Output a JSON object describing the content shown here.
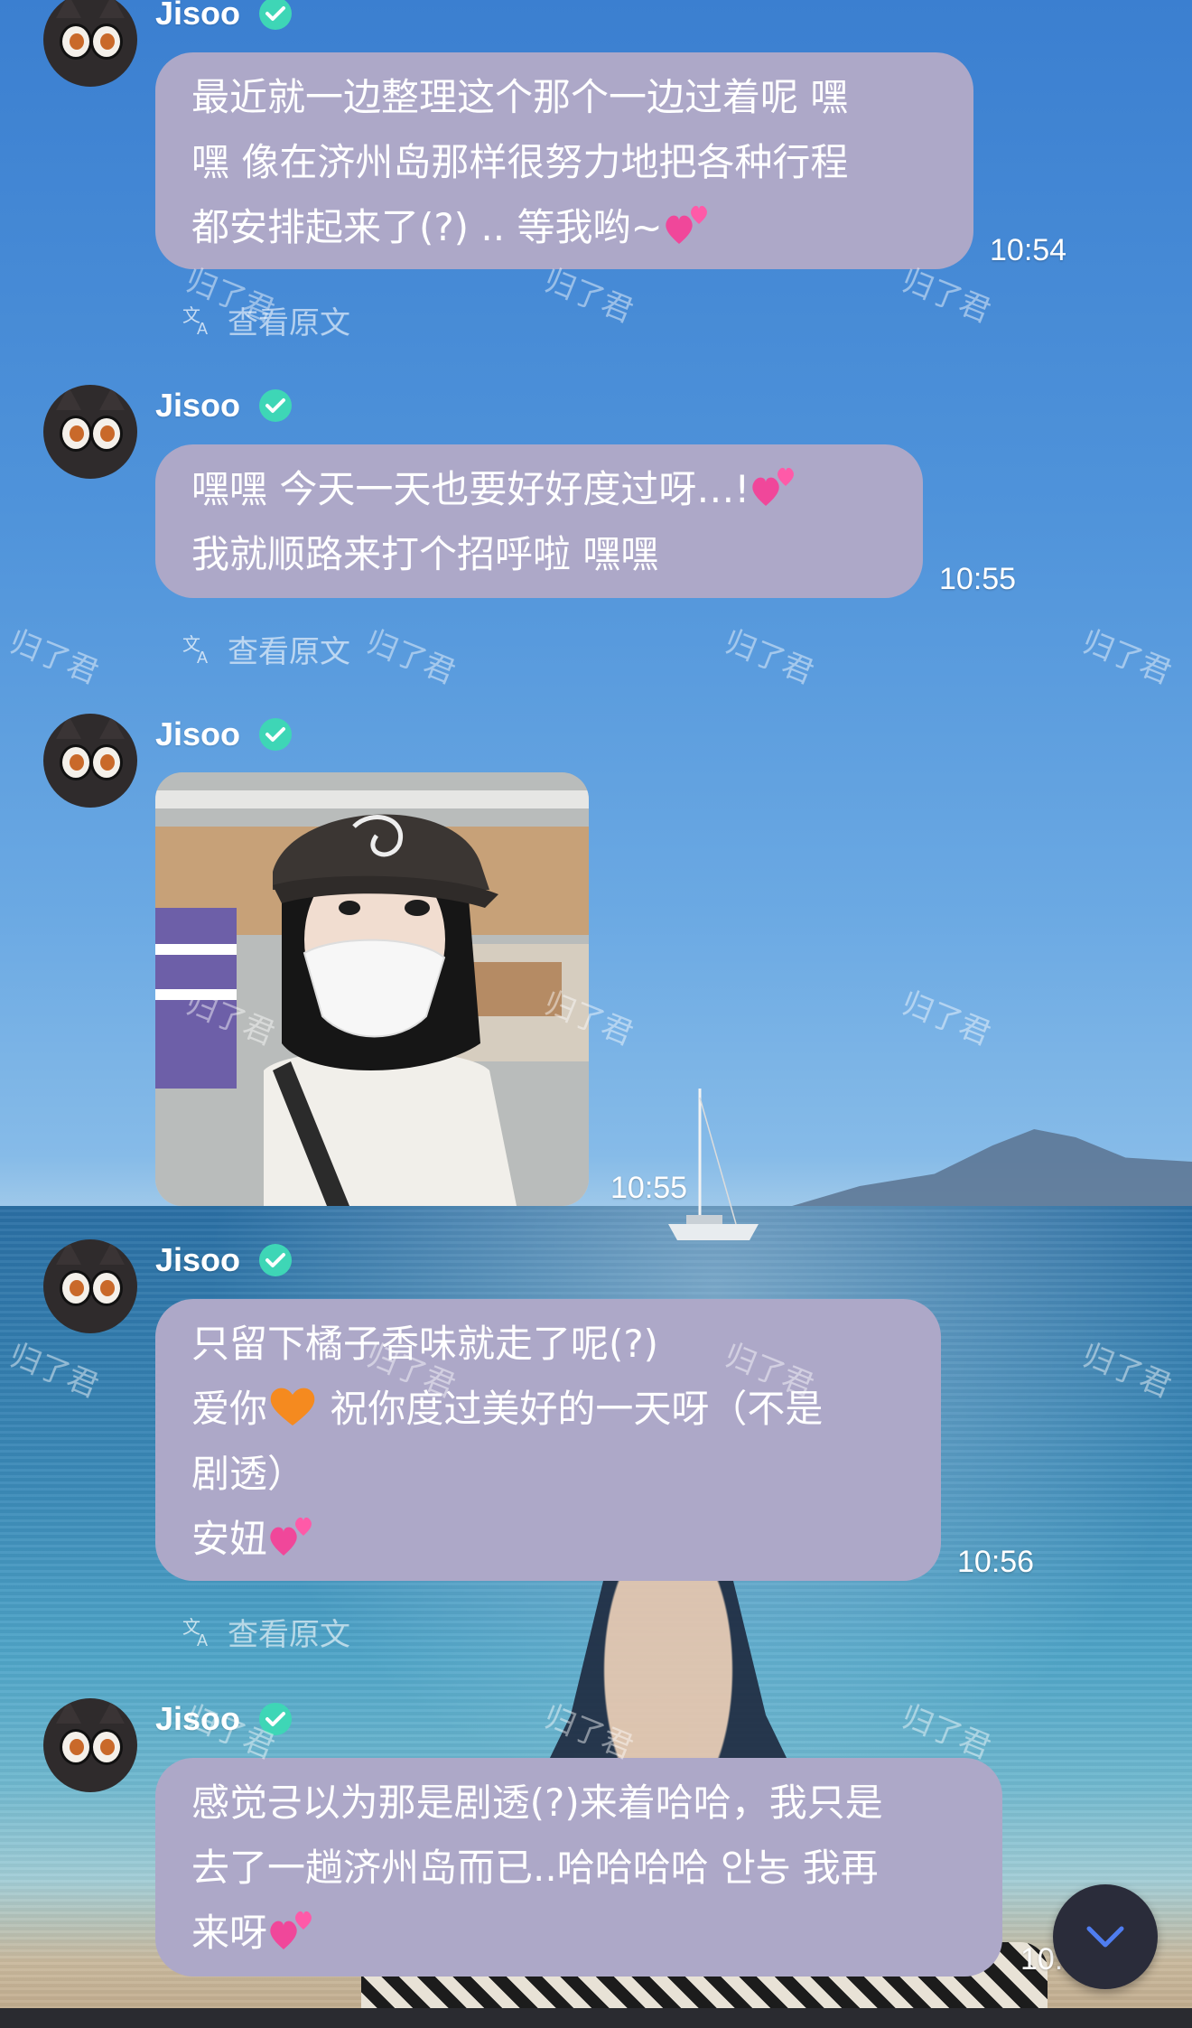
{
  "watermark": "归了君",
  "translate_label": "查看原文",
  "scroll_down_icon": "chevron-down-icon",
  "colors": {
    "bubble": "#ada8c8",
    "verified": "#3ed6b6",
    "scroll_button": "#2a2c3a",
    "chevron": "#4f7df0"
  },
  "messages": [
    {
      "sender": "Jisoo",
      "lines": [
        "最近就一边整理这个那个一边过着呢 嘿",
        "嘿 像在济州岛那样很努力地把各种行程",
        "都安排起来了(?) .. 等我哟~"
      ],
      "time": "10:54"
    },
    {
      "sender": "Jisoo",
      "lines": [
        "嘿嘿 今天一天也要好好度过呀…!",
        "我就顺路来打个招呼啦 嘿嘿"
      ],
      "time": "10:55"
    },
    {
      "sender": "Jisoo",
      "time": "10:55"
    },
    {
      "sender": "Jisoo",
      "lines": [
        "只留下橘子香味就走了呢(?)",
        "爱你",
        " 祝你度过美好的一天呀（不是",
        "剧透）",
        "安妞"
      ],
      "time": "10:56"
    },
    {
      "sender": "Jisoo",
      "lines": [
        "感觉긍以为那是剧透(?)来着哈哈，我只是",
        "去了一趟济州岛而已..哈哈哈哈 안농 我再",
        "来呀"
      ],
      "time": "10:"
    }
  ]
}
